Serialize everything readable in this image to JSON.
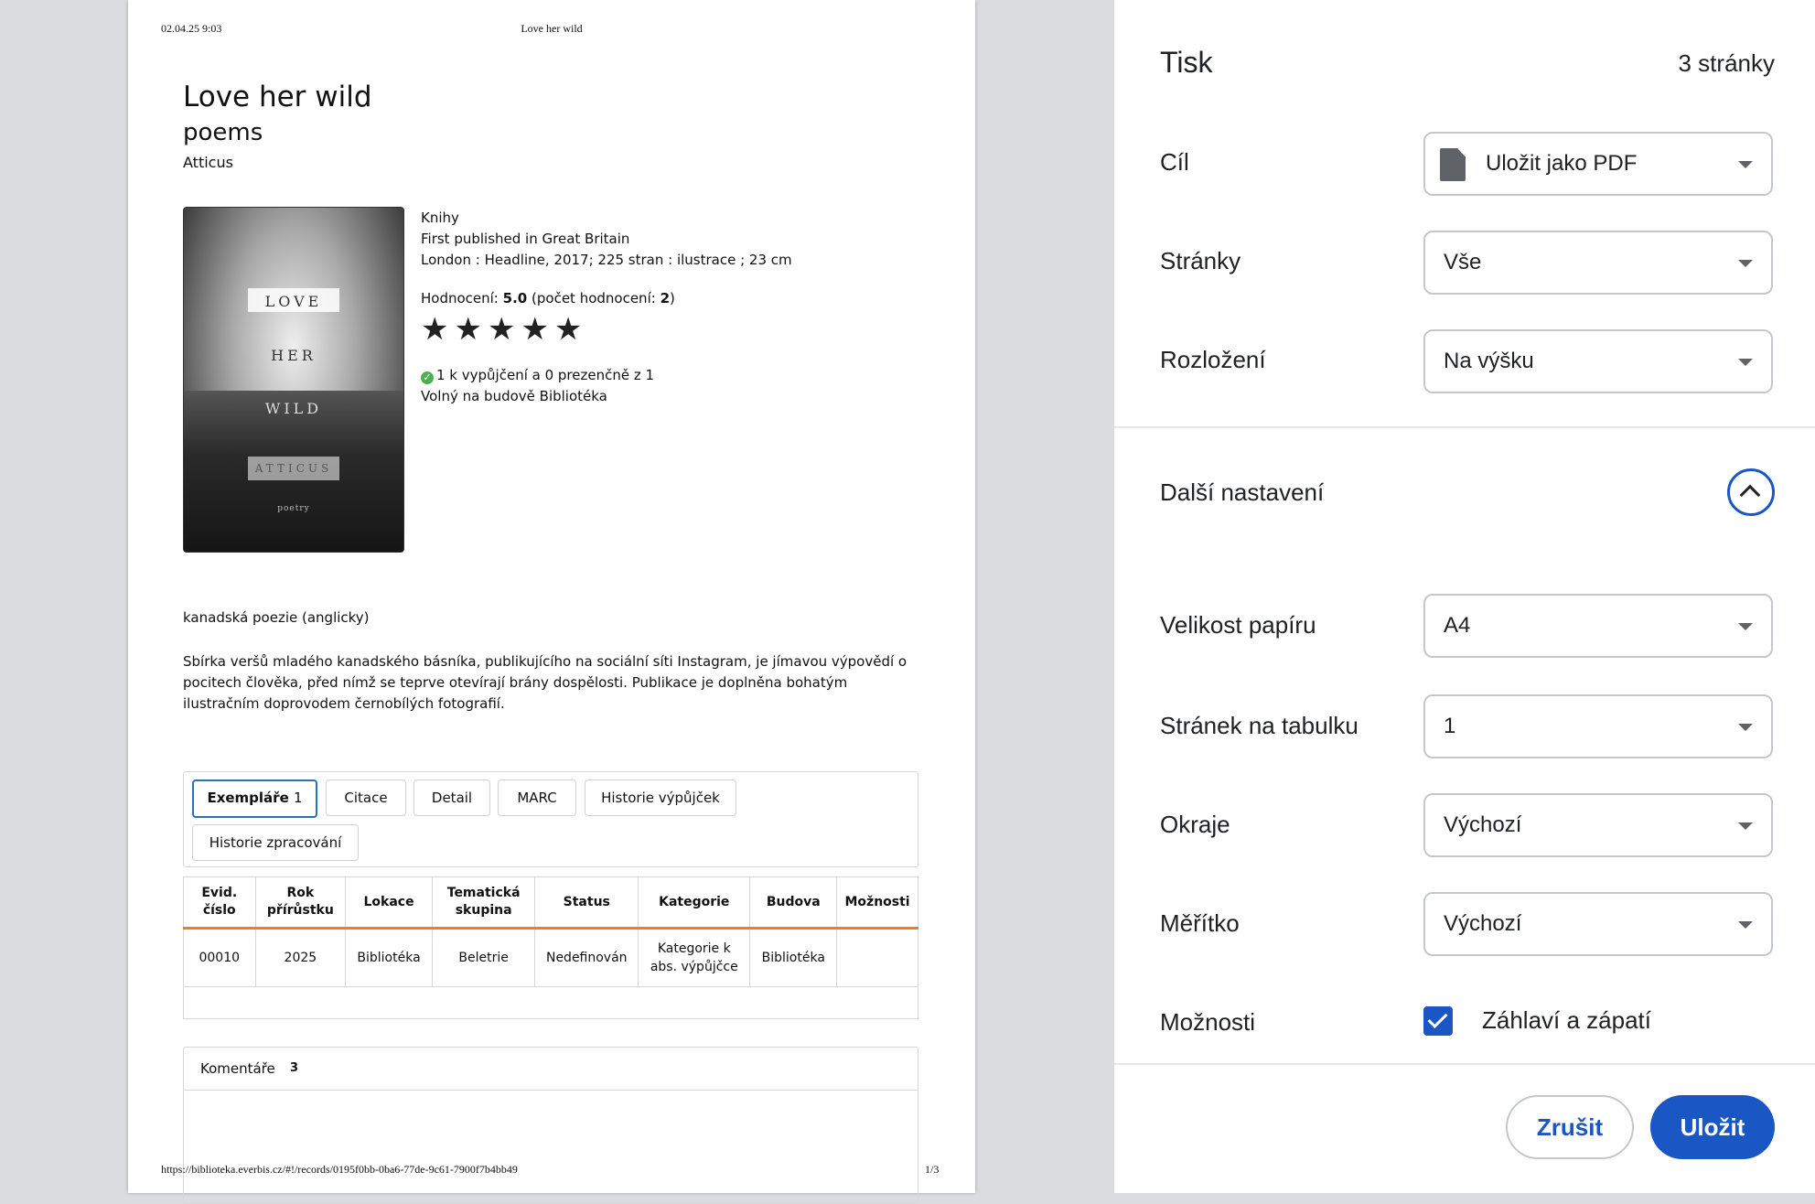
{
  "document": {
    "header_datetime": "02.04.25 9:03",
    "header_title": "Love her wild",
    "title": "Love her wild",
    "subtitle": "poems",
    "author": "Atticus",
    "cover_words": [
      "LOVE",
      "HER",
      "WILD",
      "ATTICUS",
      "poetry"
    ],
    "meta": {
      "type": "Knihy",
      "published": "First published in Great Britain",
      "imprint": "London : Headline, 2017; 225 stran : ilustrace ; 23 cm",
      "rating_label": "Hodnocení:",
      "rating_value": "5.0",
      "rating_count_label": "(počet hodnocení:",
      "rating_count": "2",
      "rating_close": ")",
      "stars": "★★★★★",
      "rating_stars": 5,
      "availability": "1 k vypůjčení a 0 prezenčně z 1",
      "location": "Volný na budově Bibliotéka"
    },
    "genre": "kanadská poezie (anglicky)",
    "description": "Sbírka veršů mladého kanadského básníka, publikujícího na sociální síti Instagram, je jímavou výpovědí o pocitech člověka, před nímž se teprve otevírají brány dospělosti. Publikace je doplněna bohatým ilustračním doprovodem černobílých fotografií.",
    "tabs": {
      "exemplare": "Exempláře",
      "exemplare_count": "1",
      "citace": "Citace",
      "detail": "Detail",
      "marc": "MARC",
      "historie_vypujcek": "Historie výpůjček",
      "historie_zpracovani": "Historie zpracování"
    },
    "table": {
      "headers": [
        "Evid. číslo",
        "Rok přírůstku",
        "Lokace",
        "Tematická skupina",
        "Status",
        "Kategorie",
        "Budova",
        "Možnosti"
      ],
      "row": [
        "00010",
        "2025",
        "Bibliotéka",
        "Beletrie",
        "Nedefinován",
        "Kategorie k abs. výpůjčce",
        "Bibliotéka",
        ""
      ]
    },
    "comments_label": "Komentáře",
    "comments_count": "3",
    "footer_url": "https://biblioteka.everbis.cz/#!/records/0195f0bb-0ba6-77de-9c61-7900f7b4bb49",
    "footer_page": "1/3"
  },
  "panel": {
    "title": "Tisk",
    "pages_count": "3 stránky",
    "destination_label": "Cíl",
    "destination_value": "Uložit jako PDF",
    "pages_label": "Stránky",
    "pages_value": "Vše",
    "layout_label": "Rozložení",
    "layout_value": "Na výšku",
    "more_settings_label": "Další nastavení",
    "paper_label": "Velikost papíru",
    "paper_value": "A4",
    "per_sheet_label": "Stránek na tabulku",
    "per_sheet_value": "1",
    "margins_label": "Okraje",
    "margins_value": "Výchozí",
    "scale_label": "Měřítko",
    "scale_value": "Výchozí",
    "options_label": "Možnosti",
    "header_footer_label": "Záhlaví a zápatí",
    "cancel_label": "Zrušit",
    "save_label": "Uložit",
    "accent_color": "#1a56c4"
  }
}
